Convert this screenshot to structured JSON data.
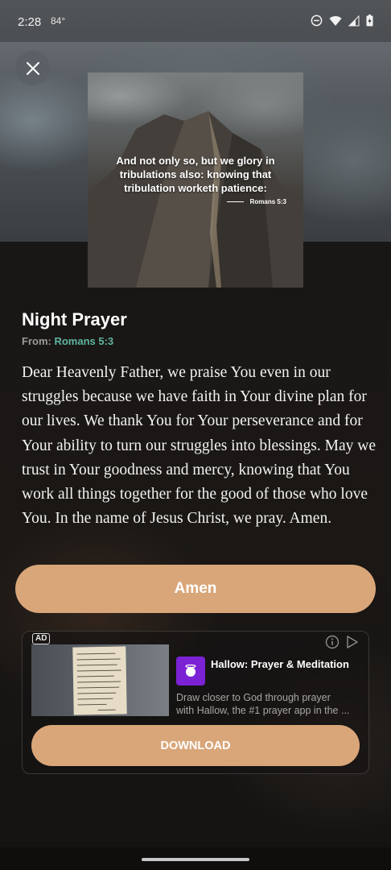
{
  "status_bar": {
    "time": "2:28",
    "temperature": "84°"
  },
  "verse_card": {
    "text": "And not only so, but we glory in tribulations also: knowing that tribulation worketh patience:",
    "reference": "Romans 5:3"
  },
  "prayer": {
    "title": "Night Prayer",
    "from_label": "From:",
    "from_reference": "Romans 5:3",
    "body": "Dear Heavenly Father, we praise You even in our struggles because we have faith in Your divine plan for our lives. We thank You for Your perseverance and for Your ability to turn our struggles into blessings. May we trust in Your goodness and mercy, knowing that You work all things together for the good of those who love You. In the name of Jesus Christ, we pray. Amen."
  },
  "amen_button": {
    "label": "Amen"
  },
  "ad": {
    "badge": "AD",
    "app_name": "Hallow: Prayer & Meditation",
    "description_line1": "Draw closer to God through prayer",
    "description_line2": "with Hallow, the #1 prayer app in the ...",
    "download_label": "DOWNLOAD"
  },
  "colors": {
    "accent": "#d9a679",
    "link_green": "#5fb5a0",
    "ad_icon_purple": "#7b22d4"
  },
  "icons": [
    "close-icon",
    "do-not-disturb-icon",
    "wifi-icon",
    "signal-icon",
    "battery-icon",
    "ad-info-icon",
    "ad-choices-icon",
    "hallow-app-icon"
  ]
}
